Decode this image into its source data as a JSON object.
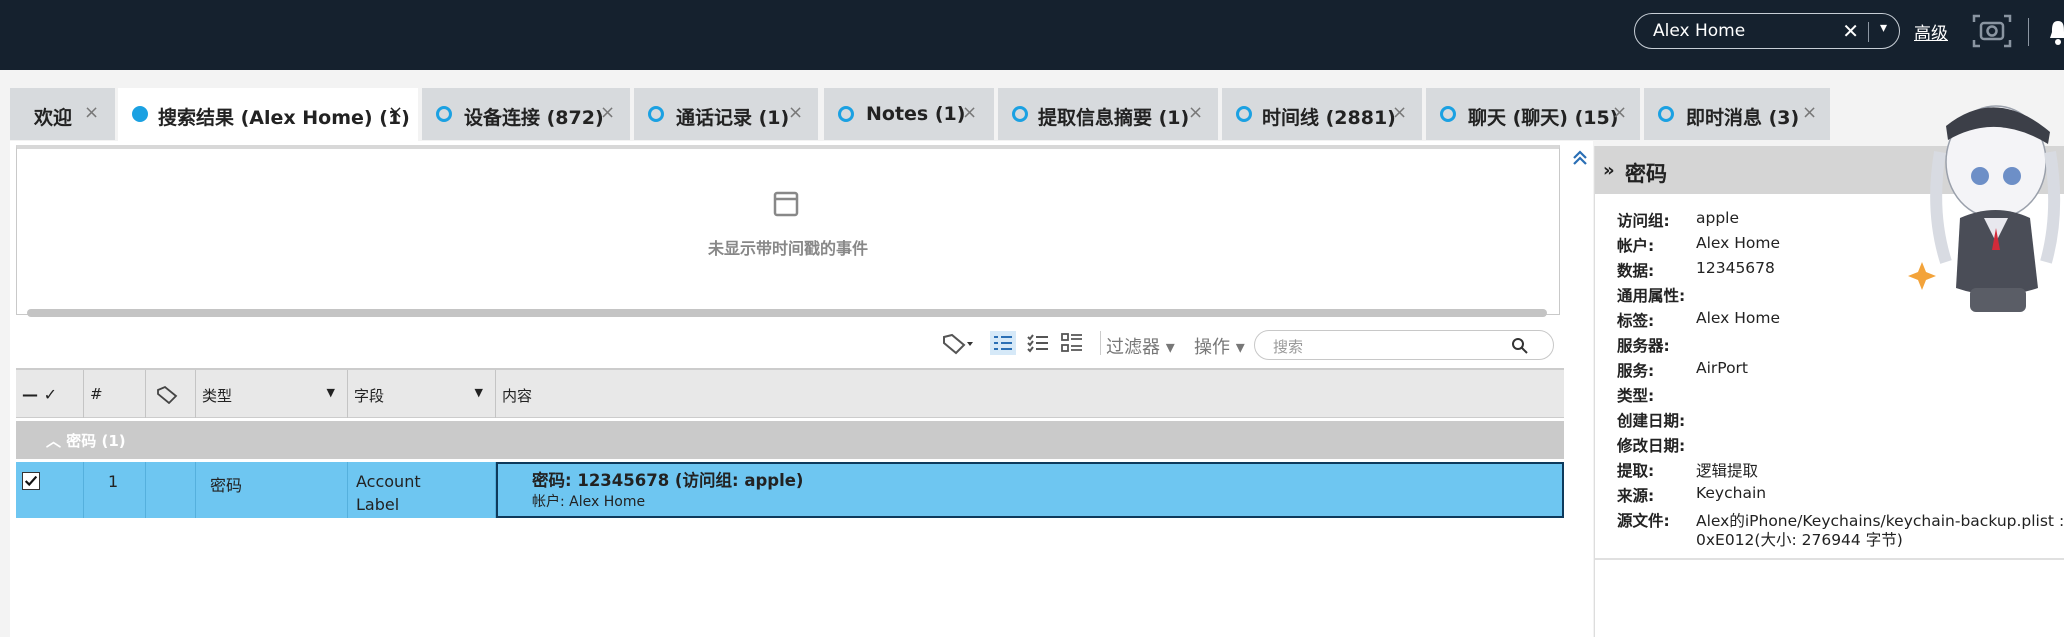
{
  "topbar": {
    "search_value": "Alex Home",
    "clear_glyph": "✕",
    "dropdown_glyph": "▾",
    "advanced_label": "高级"
  },
  "tabs": [
    {
      "label": "欢迎",
      "has_dot": false
    },
    {
      "label": "搜索结果 (Alex Home) (1)",
      "has_dot": true,
      "active": true
    },
    {
      "label": "设备连接 (872)",
      "has_dot": true
    },
    {
      "label": "通话记录 (1)",
      "has_dot": true
    },
    {
      "label": "Notes (1)",
      "has_dot": true
    },
    {
      "label": "提取信息摘要 (1)",
      "has_dot": true
    },
    {
      "label": "时间线 (2881)",
      "has_dot": true
    },
    {
      "label": "聊天 (聊天) (15)",
      "has_dot": true
    },
    {
      "label": "即时消息 (3)",
      "has_dot": true
    }
  ],
  "tab_close_glyph": "×",
  "timeline": {
    "empty_text": "未显示带时间戳的事件"
  },
  "toolbar": {
    "filter_label": "过滤器 ▾",
    "action_label": "操作 ▾",
    "search_placeholder": "搜索"
  },
  "grid": {
    "headers": {
      "select": "— ✓",
      "num": "#",
      "type": "类型",
      "field": "字段",
      "content": "内容"
    },
    "group": {
      "label": "密码 (1)",
      "chevron": "︿"
    },
    "rows": [
      {
        "num": "1",
        "type": "密码",
        "field_line1": "Account",
        "field_line2": "Label",
        "content_title": "密码: 12345678 (访问组: apple)",
        "content_sub": "帐户: Alex Home",
        "checked": true
      }
    ]
  },
  "details": {
    "title": "密码",
    "expand_glyph": "»",
    "fields": [
      {
        "k": "访问组:",
        "v": "apple"
      },
      {
        "k": "帐户:",
        "v": "Alex Home"
      },
      {
        "k": "数据:",
        "v": "12345678"
      },
      {
        "k": "通用属性:",
        "v": ""
      },
      {
        "k": "标签:",
        "v": "Alex Home"
      },
      {
        "k": "服务器:",
        "v": ""
      },
      {
        "k": "服务:",
        "v": "AirPort"
      },
      {
        "k": "类型:",
        "v": ""
      },
      {
        "k": "创建日期:",
        "v": ""
      },
      {
        "k": "修改日期:",
        "v": ""
      },
      {
        "k": "提取:",
        "v": "逻辑提取"
      },
      {
        "k": "来源:",
        "v": "Keychain"
      },
      {
        "k": "源文件:",
        "v": "Alex的iPhone/Keychains/keychain-backup.plist :",
        "v2": "0xE012(大小: 276944 字节)"
      }
    ]
  },
  "colors": {
    "topbar": "#15212e",
    "accent": "#1ba1e2",
    "selected_row": "#6ec6f1"
  }
}
